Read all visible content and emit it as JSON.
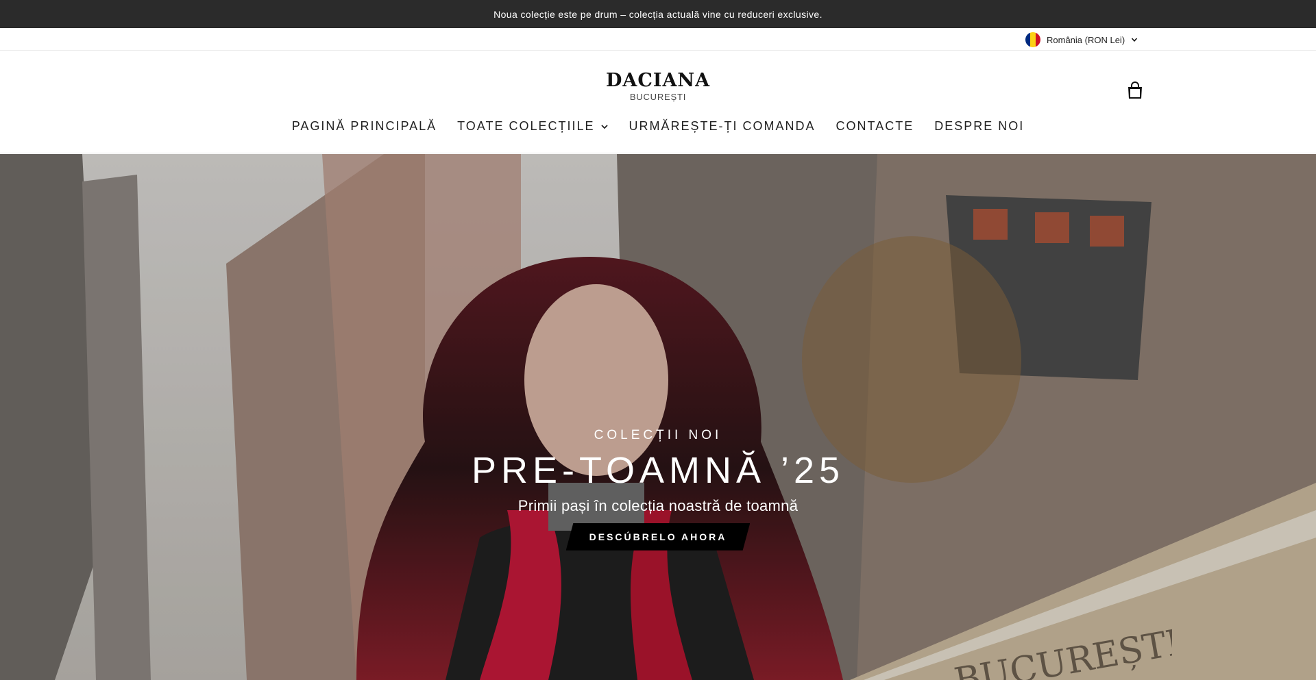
{
  "announcement": "Noua colecție este pe drum – colecția actuală vine cu reduceri exclusive.",
  "locale": {
    "label": "România (RON Lei)",
    "flag_colors": [
      "#002B7F",
      "#FCD116",
      "#CE1126"
    ]
  },
  "brand": {
    "name": "DACIANA",
    "city": "BUCUREȘTI"
  },
  "nav": {
    "items": [
      {
        "label": "PAGINĂ PRINCIPALĂ"
      },
      {
        "label": "TOATE COLECȚIILE"
      },
      {
        "label": "URMĂREȘTE-ȚI COMANDA"
      },
      {
        "label": "CONTACTE"
      },
      {
        "label": "DESPRE NOI"
      }
    ]
  },
  "hero": {
    "eyebrow": "COLECȚII NOI",
    "title": "PRE-TOAMNĂ ’25",
    "subtitle": "Primii pași în colecția noastră de toamnă",
    "cta": "DESCÚBRELO AHORA",
    "sign_text": "BUCUREȘTI"
  },
  "icons": {
    "cart": "shopping-bag-icon",
    "dropdown": "chevron-down-icon"
  }
}
